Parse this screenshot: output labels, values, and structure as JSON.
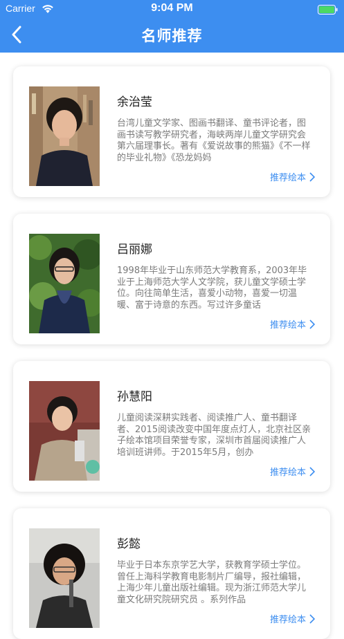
{
  "status_bar": {
    "carrier": "Carrier",
    "time": "9:04 PM"
  },
  "nav": {
    "title": "名师推荐"
  },
  "teachers": [
    {
      "name": "余治莹",
      "desc": "台湾儿童文学家、图画书翻译、童书评论者，图画书读写教学研究者，海峡两岸儿童文学研究会第六届理事长。著有《爱说故事的熊猫》《不一样的毕业礼物》《恐龙妈妈",
      "link": "推荐绘本"
    },
    {
      "name": "吕丽娜",
      "desc": "1998年毕业于山东师范大学教育系，2003年毕业于上海师范大学人文学院，获儿童文学硕士学位。向往简单生活，喜爱小动物，喜爱一切温暖、富于诗意的东西。写过许多童话",
      "link": "推荐绘本"
    },
    {
      "name": "孙慧阳",
      "desc": "儿童阅读深耕实践者、阅读推广人、童书翻译者、2015阅读改变中国年度点灯人，北京社区亲子绘本馆项目荣誉专家，深圳市首届阅读推广人培训班讲师。于2015年5月，创办",
      "link": "推荐绘本"
    },
    {
      "name": "彭懿",
      "desc": "毕业于日本东京学艺大学，获教育学硕士学位。 曾任上海科学教育电影制片厂编导，报社编辑，上海少年儿童出版社编辑。现为浙江师范大学儿童文化研究院研究员 。系列作品",
      "link": "推荐绘本"
    }
  ],
  "colors": {
    "accent": "#3d8ef0",
    "battery": "#4cd964"
  }
}
